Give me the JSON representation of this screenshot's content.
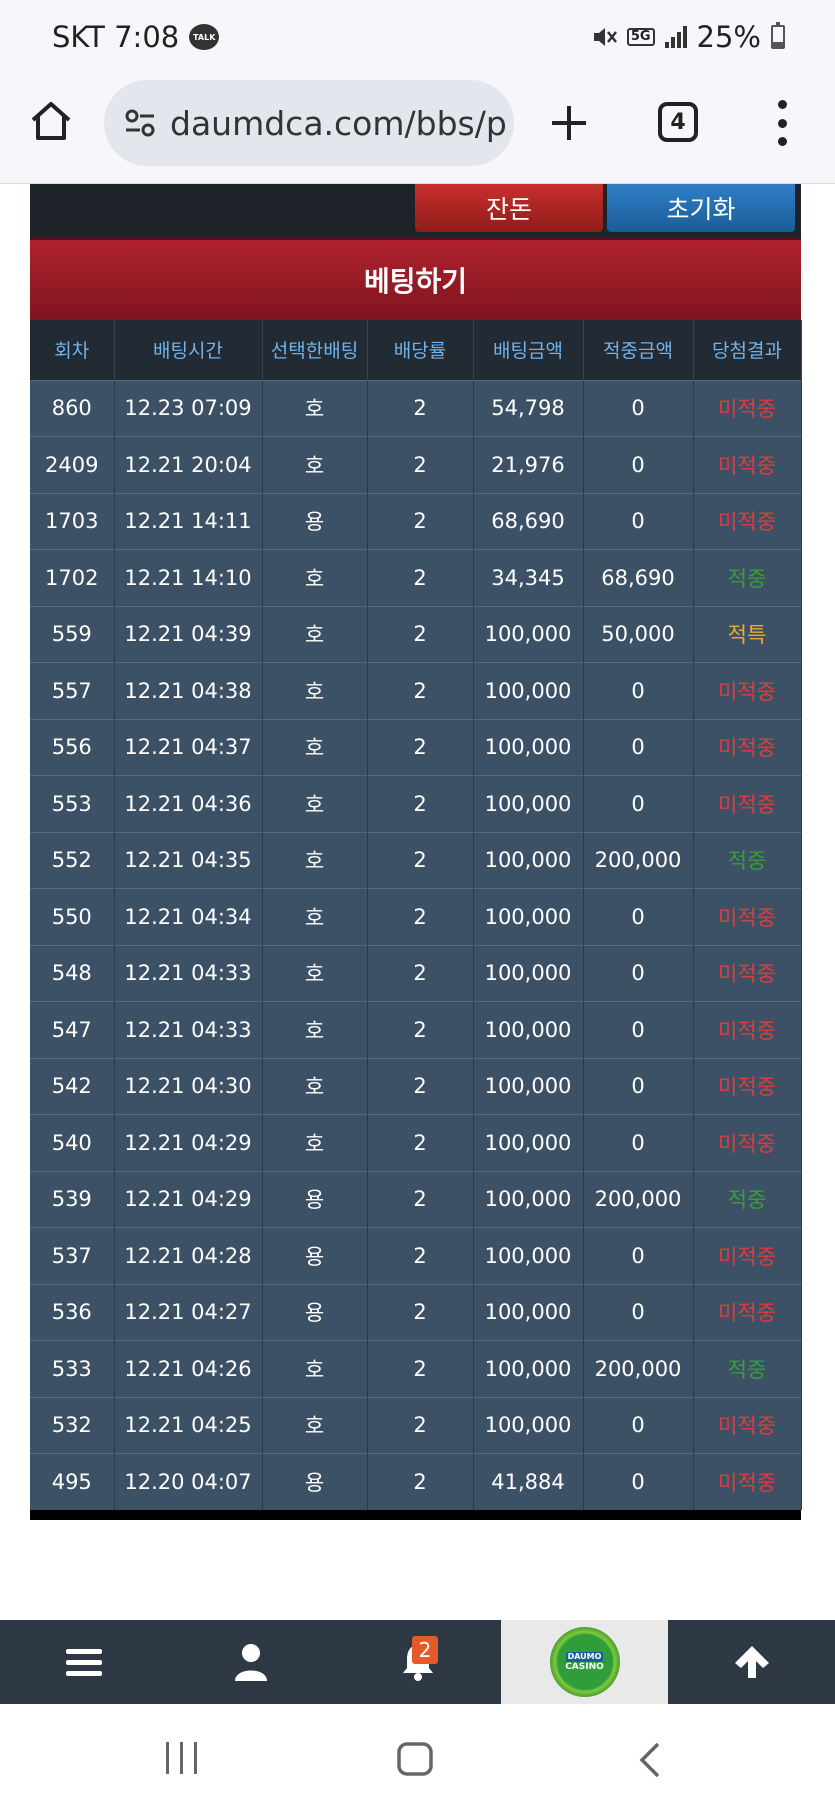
{
  "status_bar": {
    "carrier_time": "SKT 7:08",
    "talk_badge": "TALK",
    "network": "5G",
    "battery": "25%"
  },
  "browser": {
    "url": "daumdca.com/bbs/p",
    "tab_count": "4"
  },
  "buttons": {
    "balance": "잔돈",
    "reset": "초기화"
  },
  "bet_title": "베팅하기",
  "table": {
    "headers": [
      "회차",
      "배팅시간",
      "선택한배팅",
      "배당률",
      "배팅금액",
      "적중금액",
      "당첨결과"
    ],
    "rows": [
      {
        "round": "860",
        "time": "12.23 07:09",
        "pick": "호",
        "odds": "2",
        "amount": "54,798",
        "win": "0",
        "result": "미적중",
        "status": "lose"
      },
      {
        "round": "2409",
        "time": "12.21 20:04",
        "pick": "호",
        "odds": "2",
        "amount": "21,976",
        "win": "0",
        "result": "미적중",
        "status": "lose"
      },
      {
        "round": "1703",
        "time": "12.21 14:11",
        "pick": "용",
        "odds": "2",
        "amount": "68,690",
        "win": "0",
        "result": "미적중",
        "status": "lose"
      },
      {
        "round": "1702",
        "time": "12.21 14:10",
        "pick": "호",
        "odds": "2",
        "amount": "34,345",
        "win": "68,690",
        "result": "적중",
        "status": "win"
      },
      {
        "round": "559",
        "time": "12.21 04:39",
        "pick": "호",
        "odds": "2",
        "amount": "100,000",
        "win": "50,000",
        "result": "적특",
        "status": "tie"
      },
      {
        "round": "557",
        "time": "12.21 04:38",
        "pick": "호",
        "odds": "2",
        "amount": "100,000",
        "win": "0",
        "result": "미적중",
        "status": "lose"
      },
      {
        "round": "556",
        "time": "12.21 04:37",
        "pick": "호",
        "odds": "2",
        "amount": "100,000",
        "win": "0",
        "result": "미적중",
        "status": "lose"
      },
      {
        "round": "553",
        "time": "12.21 04:36",
        "pick": "호",
        "odds": "2",
        "amount": "100,000",
        "win": "0",
        "result": "미적중",
        "status": "lose"
      },
      {
        "round": "552",
        "time": "12.21 04:35",
        "pick": "호",
        "odds": "2",
        "amount": "100,000",
        "win": "200,000",
        "result": "적중",
        "status": "win"
      },
      {
        "round": "550",
        "time": "12.21 04:34",
        "pick": "호",
        "odds": "2",
        "amount": "100,000",
        "win": "0",
        "result": "미적중",
        "status": "lose"
      },
      {
        "round": "548",
        "time": "12.21 04:33",
        "pick": "호",
        "odds": "2",
        "amount": "100,000",
        "win": "0",
        "result": "미적중",
        "status": "lose"
      },
      {
        "round": "547",
        "time": "12.21 04:33",
        "pick": "호",
        "odds": "2",
        "amount": "100,000",
        "win": "0",
        "result": "미적중",
        "status": "lose"
      },
      {
        "round": "542",
        "time": "12.21 04:30",
        "pick": "호",
        "odds": "2",
        "amount": "100,000",
        "win": "0",
        "result": "미적중",
        "status": "lose"
      },
      {
        "round": "540",
        "time": "12.21 04:29",
        "pick": "호",
        "odds": "2",
        "amount": "100,000",
        "win": "0",
        "result": "미적중",
        "status": "lose"
      },
      {
        "round": "539",
        "time": "12.21 04:29",
        "pick": "용",
        "odds": "2",
        "amount": "100,000",
        "win": "200,000",
        "result": "적중",
        "status": "win"
      },
      {
        "round": "537",
        "time": "12.21 04:28",
        "pick": "용",
        "odds": "2",
        "amount": "100,000",
        "win": "0",
        "result": "미적중",
        "status": "lose"
      },
      {
        "round": "536",
        "time": "12.21 04:27",
        "pick": "용",
        "odds": "2",
        "amount": "100,000",
        "win": "0",
        "result": "미적중",
        "status": "lose"
      },
      {
        "round": "533",
        "time": "12.21 04:26",
        "pick": "호",
        "odds": "2",
        "amount": "100,000",
        "win": "200,000",
        "result": "적중",
        "status": "win"
      },
      {
        "round": "532",
        "time": "12.21 04:25",
        "pick": "호",
        "odds": "2",
        "amount": "100,000",
        "win": "0",
        "result": "미적중",
        "status": "lose"
      },
      {
        "round": "495",
        "time": "12.20 04:07",
        "pick": "용",
        "odds": "2",
        "amount": "41,884",
        "win": "0",
        "result": "미적중",
        "status": "lose"
      }
    ]
  },
  "bottom_nav": {
    "notification_count": "2",
    "logo_top": "DAUMO",
    "logo_bottom": "CASINO",
    "icons": [
      "hamburger-icon",
      "user-icon",
      "bell-icon",
      "logo",
      "arrow-up-icon"
    ]
  },
  "colors": {
    "lose": "#e23b3b",
    "win": "#37a035",
    "tie": "#f0a830",
    "row_bg": "#3d5166",
    "header_text": "#6fb3ea"
  }
}
